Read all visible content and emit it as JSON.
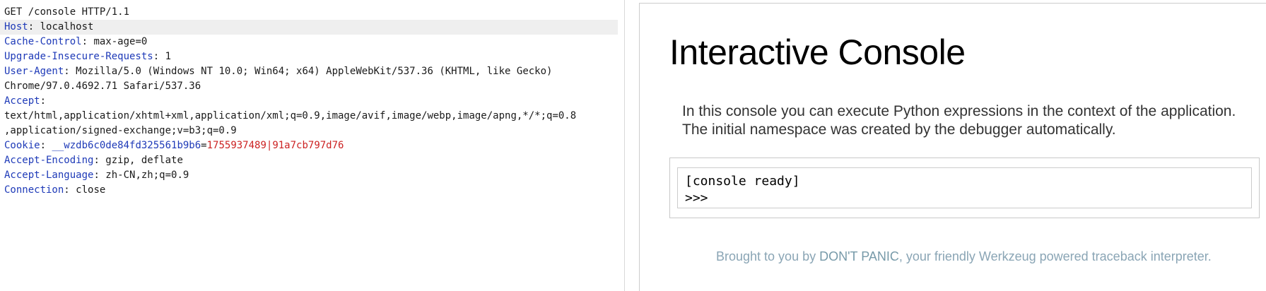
{
  "request": {
    "request_line": "GET /console HTTP/1.1",
    "headers": [
      {
        "name": "Host",
        "value": " localhost"
      },
      {
        "name": "Cache-Control",
        "value": " max-age=0"
      },
      {
        "name": "Upgrade-Insecure-Requests",
        "value": " 1"
      },
      {
        "name": "User-Agent",
        "value": " Mozilla/5.0 (Windows NT 10.0; Win64; x64) AppleWebKit/537.36 (KHTML, like Gecko)"
      },
      {
        "name": "",
        "value": "Chrome/97.0.4692.71 Safari/537.36"
      },
      {
        "name": "Accept",
        "value": ""
      },
      {
        "name": "",
        "value": "text/html,application/xhtml+xml,application/xml;q=0.9,image/avif,image/webp,image/apng,*/*;q=0.8"
      },
      {
        "name": "",
        "value": ",application/signed-exchange;v=b3;q=0.9"
      },
      {
        "name": "Accept-Encoding",
        "value": " gzip, deflate"
      },
      {
        "name": "Accept-Language",
        "value": " zh-CN,zh;q=0.9"
      },
      {
        "name": "Connection",
        "value": " close"
      }
    ],
    "cookie": {
      "label": "Cookie",
      "name": " __wzdb6c0de84fd325561b9b6",
      "value": "1755937489|91a7cb797d76"
    },
    "colors": {
      "header_name": "#1e3ab8",
      "cookie_value": "#cc2222",
      "highlight": "#efefef"
    }
  },
  "console": {
    "title": "Interactive Console",
    "description": "In this console you can execute Python expressions in the context of the application. The initial namespace was created by the debugger automatically.",
    "output_line": "[console ready]",
    "prompt": ">>>",
    "footer_prefix": "Brought to you by ",
    "footer_brand": "DON'T PANIC",
    "footer_middle": ", your friendly ",
    "footer_link": "Werkzeug",
    "footer_suffix": " powered traceback interpreter."
  }
}
